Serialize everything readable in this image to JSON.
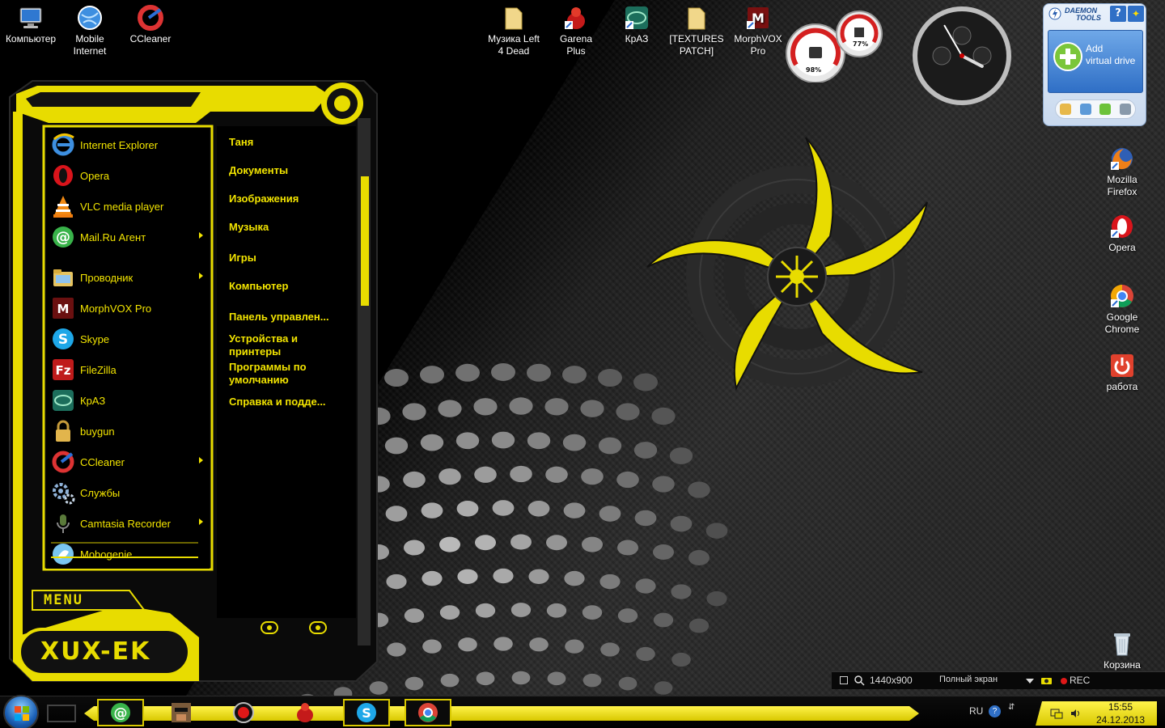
{
  "desktop": {
    "left_icons": [
      {
        "label": "Компьютер",
        "icon": "computer-icon"
      },
      {
        "label": "Mobile\nInternet",
        "icon": "globe-icon"
      },
      {
        "label": "CCleaner",
        "icon": "ccleaner-icon"
      }
    ],
    "top_icons": [
      {
        "label": "Музика Left\n4 Dead",
        "icon": "folder-icon"
      },
      {
        "label": "Garena\nPlus",
        "icon": "garena-icon"
      },
      {
        "label": "КрАЗ",
        "icon": "kraz-icon"
      },
      {
        "label": "[TEXTURES\nPATCH]",
        "icon": "folder-icon"
      },
      {
        "label": "MorphVOX\nPro",
        "icon": "morphvox-icon"
      }
    ],
    "right_icons": [
      {
        "label": "Mozilla\nFirefox",
        "icon": "firefox-icon"
      },
      {
        "label": "Opera",
        "icon": "opera-icon"
      },
      {
        "label": "Google\nChrome",
        "icon": "chrome-icon"
      },
      {
        "label": "работа",
        "icon": "power-icon"
      },
      {
        "label": "Корзина",
        "icon": "recycle-bin-icon"
      }
    ]
  },
  "gadgets": {
    "cpu_meter": {
      "cpu_percent": "98%",
      "memory_percent": "77%"
    },
    "clock": {
      "hour": 3,
      "minute": 55
    },
    "daemon_tools": {
      "brand_line1": "DAEMON",
      "brand_line2": "TOOLS",
      "add_label": "Add\nvirtual drive",
      "help": "?"
    }
  },
  "start_menu": {
    "logo": "XUX-EK",
    "menu_label": "MENU",
    "programs": [
      {
        "label": "Internet Explorer",
        "icon": "ie-icon",
        "submenu": false
      },
      {
        "label": "Opera",
        "icon": "opera-icon",
        "submenu": false
      },
      {
        "label": "VLC media player",
        "icon": "vlc-icon",
        "submenu": false
      },
      {
        "label": "Mail.Ru Агент",
        "icon": "mailru-icon",
        "submenu": true
      },
      {
        "label": "Проводник",
        "icon": "explorer-icon",
        "submenu": true
      },
      {
        "label": "MorphVOX Pro",
        "icon": "morphvox-icon",
        "submenu": false
      },
      {
        "label": "Skype",
        "icon": "skype-icon",
        "submenu": false
      },
      {
        "label": "FileZilla",
        "icon": "filezilla-icon",
        "submenu": false
      },
      {
        "label": "КрАЗ",
        "icon": "kraz-icon",
        "submenu": false
      },
      {
        "label": "buygun",
        "icon": "lock-icon",
        "submenu": false
      },
      {
        "label": "CCleaner",
        "icon": "ccleaner-icon",
        "submenu": true
      },
      {
        "label": "Службы",
        "icon": "gear-icon",
        "submenu": false
      },
      {
        "label": "Camtasia Recorder",
        "icon": "camtasia-icon",
        "submenu": true
      },
      {
        "label": "Mobogenie",
        "icon": "mobogenie-icon",
        "submenu": false
      }
    ],
    "places": [
      "Таня",
      "Документы",
      "Изображения",
      "Музыка",
      "Игры",
      "Компьютер",
      "Панель управлен...",
      "Устройства и\nпринтеры",
      "Программы по\nумолчанию",
      "Справка и подде..."
    ]
  },
  "recorder_bar": {
    "resolution": "1440x900",
    "mode": "Полный экран",
    "rec": "REC"
  },
  "taskbar": {
    "buttons": [
      "mailru-agent",
      "duke-nukem",
      "record",
      "garena",
      "skype",
      "chrome"
    ],
    "language": "RU",
    "time": "15:55",
    "date": "24.12.2013"
  }
}
